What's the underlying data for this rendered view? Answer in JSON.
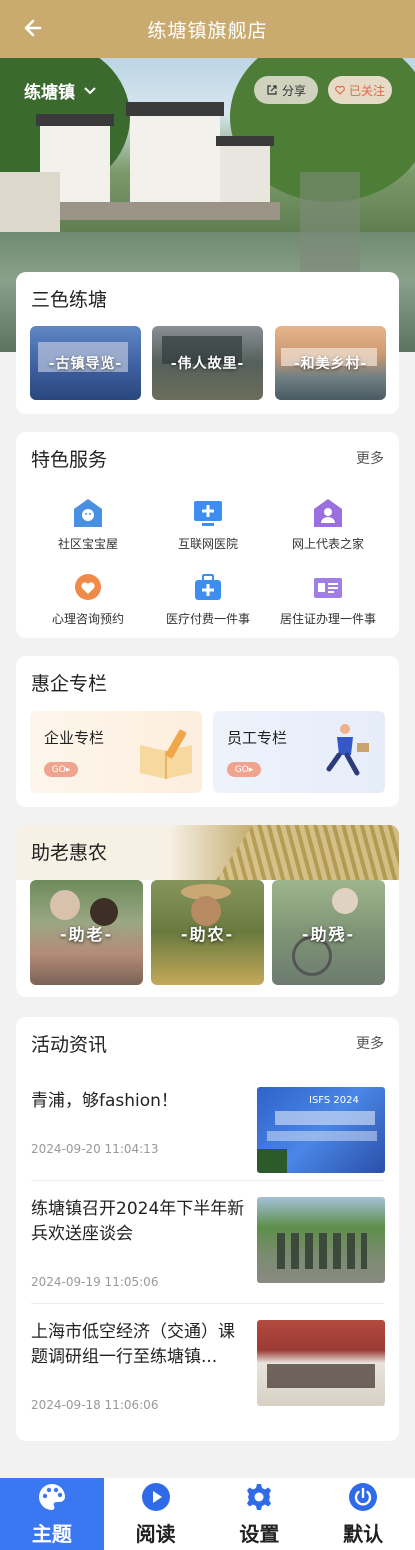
{
  "header": {
    "title": "练塘镇旗舰店"
  },
  "hero": {
    "town": "练塘镇",
    "share_label": "分享",
    "follow_label": "已关注"
  },
  "sanse": {
    "title": "三色练塘",
    "items": [
      {
        "label": "-古镇导览-"
      },
      {
        "label": "-伟人故里-"
      },
      {
        "label": "-和美乡村-"
      }
    ]
  },
  "services": {
    "title": "特色服务",
    "more": "更多",
    "items": [
      {
        "label": "社区宝宝屋",
        "icon": "baby-house-icon",
        "color": "#4a90e2"
      },
      {
        "label": "互联网医院",
        "icon": "internet-hospital-icon",
        "color": "#3d8ef0"
      },
      {
        "label": "网上代表之家",
        "icon": "representative-home-icon",
        "color": "#9b6fe0"
      },
      {
        "label": "心理咨询预约",
        "icon": "heart-consult-icon",
        "color": "#f08a4b"
      },
      {
        "label": "医疗付费一件事",
        "icon": "medical-payment-icon",
        "color": "#3d8ef0"
      },
      {
        "label": "居住证办理一件事",
        "icon": "residence-permit-icon",
        "color": "#a07ee6"
      }
    ]
  },
  "business": {
    "title": "惠企专栏",
    "items": [
      {
        "label": "企业专栏",
        "go": "GO"
      },
      {
        "label": "员工专栏",
        "go": "GO"
      }
    ]
  },
  "elderly": {
    "title": "助老惠农",
    "items": [
      {
        "label": "-助老-"
      },
      {
        "label": "-助农-"
      },
      {
        "label": "-助残-"
      }
    ]
  },
  "news": {
    "title": "活动资讯",
    "more": "更多",
    "items": [
      {
        "title": "青浦，够fashion！",
        "date": "2024-09-20 11:04:13",
        "image_text": "ISFS 2024"
      },
      {
        "title": "练塘镇召开2024年下半年新兵欢送座谈会",
        "date": "2024-09-19 11:05:06"
      },
      {
        "title": "上海市低空经济（交通）课题调研组一行至练塘镇...",
        "date": "2024-09-18 11:06:06"
      }
    ]
  },
  "tabbar": {
    "active_color": "#3a78f2",
    "items": [
      {
        "label": "主题",
        "icon": "palette-icon"
      },
      {
        "label": "阅读",
        "icon": "play-icon"
      },
      {
        "label": "设置",
        "icon": "gear-icon"
      },
      {
        "label": "默认",
        "icon": "power-icon"
      }
    ]
  }
}
